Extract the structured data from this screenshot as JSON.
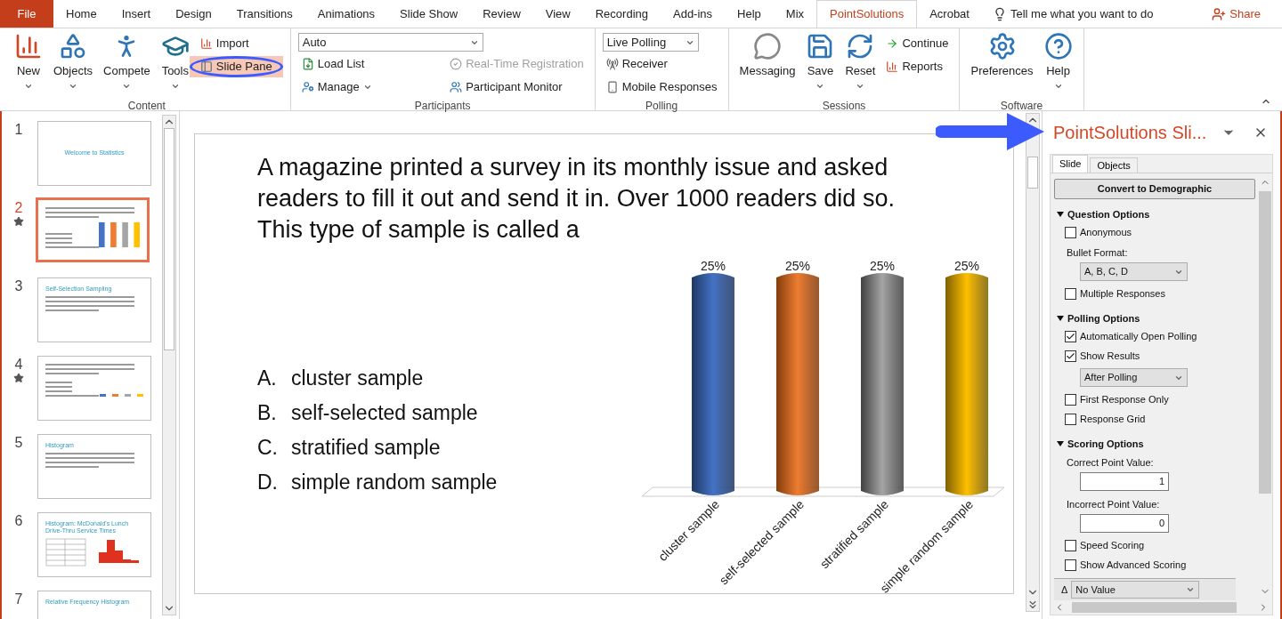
{
  "tabs": [
    {
      "label": "File",
      "kind": "file",
      "selected": false
    },
    {
      "label": "Home",
      "kind": "tab",
      "selected": false
    },
    {
      "label": "Insert",
      "kind": "tab",
      "selected": false
    },
    {
      "label": "Design",
      "kind": "tab",
      "selected": false
    },
    {
      "label": "Transitions",
      "kind": "tab",
      "selected": false
    },
    {
      "label": "Animations",
      "kind": "tab",
      "selected": false
    },
    {
      "label": "Slide Show",
      "kind": "tab",
      "selected": false
    },
    {
      "label": "Review",
      "kind": "tab",
      "selected": false
    },
    {
      "label": "View",
      "kind": "tab",
      "selected": false
    },
    {
      "label": "Recording",
      "kind": "tab",
      "selected": false
    },
    {
      "label": "Add-ins",
      "kind": "tab",
      "selected": false
    },
    {
      "label": "Help",
      "kind": "tab",
      "selected": false
    },
    {
      "label": "Mix",
      "kind": "tab",
      "selected": false
    },
    {
      "label": "PointSolutions",
      "kind": "tab",
      "selected": true
    },
    {
      "label": "Acrobat",
      "kind": "tab",
      "selected": false
    }
  ],
  "tell_me": "Tell me what you want to do",
  "share": "Share",
  "ribbon": {
    "groups": [
      {
        "label": "Content",
        "items": [
          {
            "kind": "large",
            "label": "New",
            "dropdown": true
          },
          {
            "kind": "large",
            "label": "Objects",
            "dropdown": true
          },
          {
            "kind": "large",
            "label": "Compete",
            "dropdown": true
          },
          {
            "kind": "large",
            "label": "Tools",
            "dropdown": true
          },
          {
            "kind": "small",
            "label": "Import"
          },
          {
            "kind": "small",
            "label": "Slide Pane",
            "selected": true
          }
        ]
      },
      {
        "label": "Participants",
        "items": [
          {
            "kind": "combo",
            "value": "Auto"
          },
          {
            "kind": "small",
            "label": "Load List"
          },
          {
            "kind": "small",
            "label": "Real-Time Registration",
            "disabled": true
          },
          {
            "kind": "small",
            "label": "Manage",
            "dropdown": true
          },
          {
            "kind": "small",
            "label": "Participant Monitor"
          }
        ]
      },
      {
        "label": "Polling",
        "items": [
          {
            "kind": "combo",
            "value": "Live Polling"
          },
          {
            "kind": "small",
            "label": "Receiver"
          },
          {
            "kind": "small",
            "label": "Mobile Responses"
          }
        ]
      },
      {
        "label": "Sessions",
        "items": [
          {
            "kind": "large",
            "label": "Messaging"
          },
          {
            "kind": "large",
            "label": "Save",
            "dropdown": true
          },
          {
            "kind": "large",
            "label": "Reset",
            "dropdown": true
          },
          {
            "kind": "small",
            "label": "Continue"
          },
          {
            "kind": "small",
            "label": "Reports"
          }
        ]
      },
      {
        "label": "Software",
        "items": [
          {
            "kind": "large",
            "label": "Preferences"
          },
          {
            "kind": "large",
            "label": "Help",
            "dropdown": true
          }
        ]
      }
    ]
  },
  "slides": [
    {
      "number": "1",
      "selected": false,
      "starred": false,
      "kind": "title",
      "title": "Welcome to Statistics"
    },
    {
      "number": "2",
      "selected": true,
      "starred": true,
      "kind": "question"
    },
    {
      "number": "3",
      "selected": false,
      "starred": false,
      "kind": "bullets",
      "title": "Self-Selection Sampling"
    },
    {
      "number": "4",
      "selected": false,
      "starred": true,
      "kind": "question"
    },
    {
      "number": "5",
      "selected": false,
      "starred": false,
      "kind": "bullets",
      "title": "Histogram"
    },
    {
      "number": "6",
      "selected": false,
      "starred": false,
      "kind": "table_chart",
      "title": "Histogram: McDonald's Lunch Drive-Thru Service Times"
    },
    {
      "number": "7",
      "selected": false,
      "starred": false,
      "kind": "bullets",
      "title": "Relative Frequency Histogram"
    }
  ],
  "slide": {
    "question": "A magazine printed a survey in its monthly issue and asked readers to fill it out and send it in. Over 1000 readers did so. This type of sample is called a",
    "answers": [
      {
        "letter": "A.",
        "text": "cluster sample"
      },
      {
        "letter": "B.",
        "text": "self-selected sample"
      },
      {
        "letter": "C.",
        "text": "stratified sample"
      },
      {
        "letter": "D.",
        "text": "simple random sample"
      }
    ],
    "chart_data": {
      "type": "bar",
      "categories": [
        "cluster sample",
        "self-selected sample",
        "stratified sample",
        "simple random sample"
      ],
      "values": [
        25,
        25,
        25,
        25
      ],
      "value_labels": [
        "25%",
        "25%",
        "25%",
        "25%"
      ]
    }
  },
  "pane": {
    "title": "PointSolutions Sli...",
    "tabs": [
      {
        "label": "Slide",
        "selected": true
      },
      {
        "label": "Objects",
        "selected": false
      }
    ],
    "button": "Convert to Demographic",
    "sections": [
      {
        "title": "Question Options",
        "expanded": true,
        "items": [
          {
            "kind": "checkbox",
            "label": "Anonymous",
            "checked": false
          },
          {
            "kind": "label",
            "label": "Bullet Format:"
          },
          {
            "kind": "select",
            "value": "A, B, C, D"
          },
          {
            "kind": "checkbox",
            "label": "Multiple Responses",
            "checked": false
          }
        ]
      },
      {
        "title": "Polling Options",
        "expanded": true,
        "items": [
          {
            "kind": "checkbox",
            "label": "Automatically Open Polling",
            "checked": true
          },
          {
            "kind": "checkbox",
            "label": "Show Results",
            "checked": true
          },
          {
            "kind": "select",
            "value": "After Polling"
          },
          {
            "kind": "checkbox",
            "label": "First Response Only",
            "checked": false
          },
          {
            "kind": "checkbox",
            "label": "Response Grid",
            "checked": false
          }
        ]
      },
      {
        "title": "Scoring Options",
        "expanded": true,
        "items": [
          {
            "kind": "label",
            "label": "Correct Point Value:"
          },
          {
            "kind": "number",
            "value": "1"
          },
          {
            "kind": "label",
            "label": "Incorrect Point Value:"
          },
          {
            "kind": "number",
            "value": "0"
          },
          {
            "kind": "checkbox",
            "label": "Speed Scoring",
            "checked": false
          },
          {
            "kind": "checkbox",
            "label": "Show Advanced Scoring",
            "checked": false
          }
        ]
      }
    ],
    "footer": {
      "symbol": "Δ",
      "value": "No Value"
    }
  }
}
